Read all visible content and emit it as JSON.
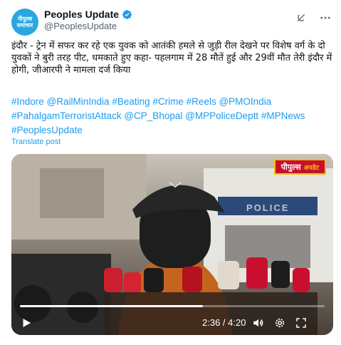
{
  "account": {
    "avatar_text_line1": "पीपुल्स",
    "avatar_text_line2": "समाचार",
    "display_name": "Peoples Update",
    "handle": "@PeoplesUpdate",
    "verified_color": "#1d9bf0"
  },
  "post": {
    "text": "इंदौर - ट्रेन में सफर कर रहे एक युवक को आतंकी हमले से जुड़ी रील देखने पर विशेष वर्ग के दो युवकों ने बुरी तरह पीट, धमकाते हुए कहा- पहलगाम में 28 मौतें हुई और 29वीं मौत तेरी इंदौर में होगी, जीआरपी ने मामला दर्ज किया",
    "hashtags": [
      "#Indore",
      "@RailMinIndia",
      "#Beating",
      "#Crime",
      "#Reels",
      "@PMOIndia",
      "#PahalgamTerroristAttack",
      "@CP_Bhopal",
      "@MPPoliceDeptt",
      "#MPNews",
      "#PeoplesUpdate"
    ],
    "translate_label": "Translate post"
  },
  "video": {
    "channel_logo": "पीपुल्स",
    "channel_logo_sub": "अपडेट",
    "vehicle_text": "POLICE",
    "current_time": "2:36",
    "duration": "4:20",
    "time_display": "2:36 / 4:20",
    "progress_fraction": 0.6
  },
  "icons": {
    "grok": "grok-icon",
    "more": "more-icon",
    "play": "play-icon",
    "volume": "volume-icon",
    "settings": "settings-icon",
    "fullscreen": "fullscreen-icon"
  }
}
